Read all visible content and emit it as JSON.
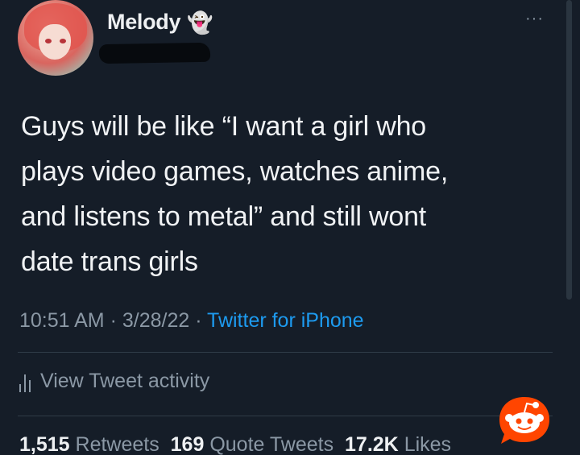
{
  "user": {
    "display_name": "Melody",
    "badge_icon": "ghost-icon",
    "badge_glyph": "👻"
  },
  "more_glyph": "···",
  "tweet": {
    "text_lines": [
      "Guys will be like “I want a girl who",
      "plays video games, watches anime,",
      "and listens to metal” and still wont",
      "date trans girls"
    ]
  },
  "meta": {
    "time": "10:51 AM",
    "sep1": " · ",
    "date": "3/28/22",
    "sep2": " · ",
    "source": "Twitter for iPhone"
  },
  "activity": {
    "label": "View Tweet activity"
  },
  "stats": {
    "retweets_count": "1,515",
    "retweets_label": "Retweets",
    "quotes_count": "169",
    "quotes_label": "Quote Tweets",
    "likes_count": "17.2K",
    "likes_label": "Likes"
  },
  "colors": {
    "background": "#151d28",
    "link": "#1d9bf0",
    "muted": "#8b98a5",
    "reddit": "#ff4500"
  }
}
